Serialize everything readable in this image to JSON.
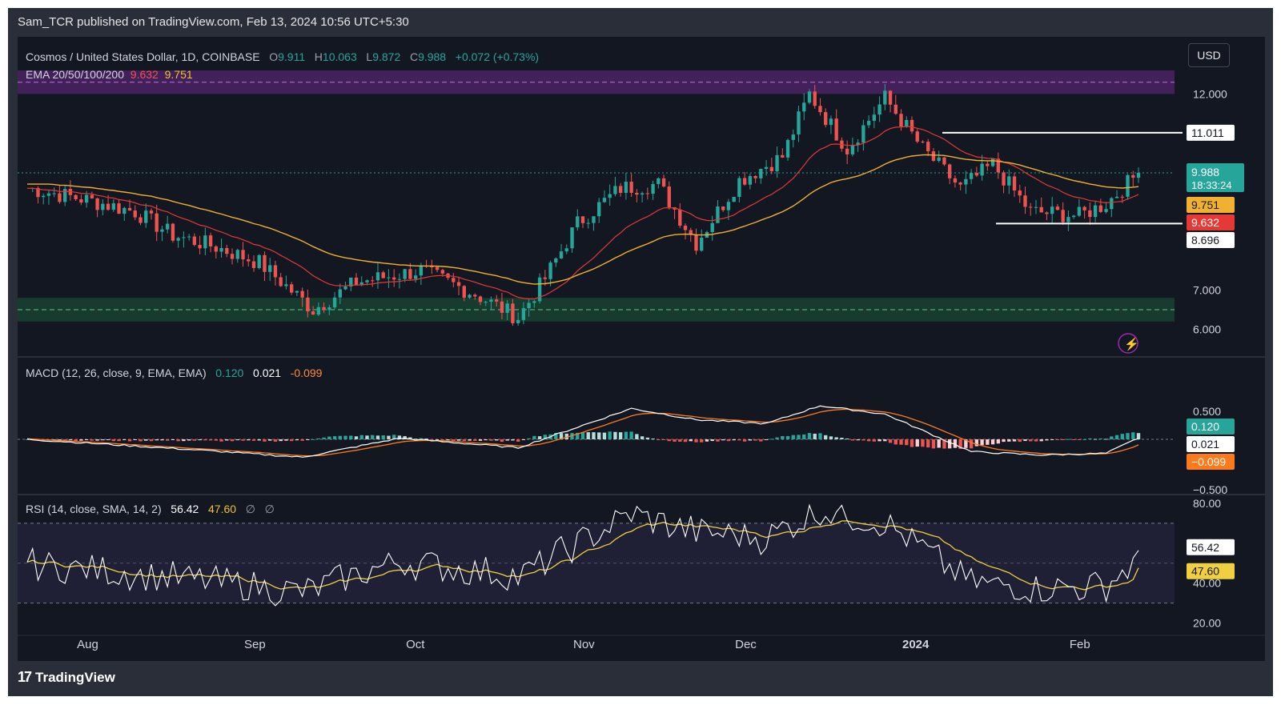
{
  "header": {
    "published_by": "Sam_TCR published on TradingView.com, Feb 13, 2024 10:56 UTC+5:30"
  },
  "footer": {
    "logo_text": "TradingView"
  },
  "currency_button": "USD",
  "symbol_legend": {
    "name": "Cosmos / United States Dollar, 1D, COINBASE",
    "o_label": "O",
    "o_value": "9.911",
    "h_label": "H",
    "h_value": "10.063",
    "l_label": "L",
    "l_value": "9.872",
    "c_label": "C",
    "c_value": "9.988",
    "change": "+0.072 (+0.73%)"
  },
  "ema_legend": {
    "name": "EMA 20/50/100/200",
    "v1": "9.632",
    "v2": "9.751"
  },
  "macd_legend": {
    "name": "MACD (12, 26, close, 9, EMA, EMA)",
    "hist": "0.120",
    "macd": "0.021",
    "signal": "-0.099"
  },
  "rsi_legend": {
    "name": "RSI (14, close, SMA, 14, 2)",
    "rsi": "56.42",
    "sma": "47.60",
    "extra1": "∅",
    "extra2": "∅"
  },
  "price_axis": {
    "ticks": [
      "12.000",
      "7.000",
      "6.000"
    ],
    "tags": {
      "resistance": "11.011",
      "last_price": "9.988",
      "countdown": "18:33:24",
      "ema50": "9.751",
      "ema20": "9.632",
      "support": "8.696"
    }
  },
  "macd_axis": {
    "ticks": [
      "0.500",
      "−0.500"
    ],
    "tags": {
      "hist": "0.120",
      "macd": "0.021",
      "signal": "−0.099"
    }
  },
  "rsi_axis": {
    "ticks": [
      "80.00",
      "40.00",
      "20.00"
    ],
    "tags": {
      "rsi": "56.42",
      "sma": "47.60"
    }
  },
  "time_axis": [
    "Aug",
    "Sep",
    "Oct",
    "Nov",
    "Dec",
    "2024",
    "Feb"
  ],
  "colors": {
    "up": "#26a69a",
    "down": "#ef5350",
    "ema20": "#e53935",
    "ema50": "#f0b030",
    "macd": "#ffffff",
    "signal": "#ff7a1a",
    "rsi": "#ffffff",
    "rsi_sma": "#f0d040",
    "resistance_zone": "#6a2a8a",
    "support_zone": "#1e5a3a"
  },
  "chart_data": [
    {
      "type": "candlestick",
      "title": "Cosmos / United States Dollar, 1D, COINBASE",
      "x_range": [
        "2024-07-21",
        "2024-02-12"
      ],
      "ylim": [
        5.5,
        12.6
      ],
      "zones": [
        {
          "name": "resistance",
          "y_range": [
            12.0,
            12.6
          ]
        },
        {
          "name": "support",
          "y_range": [
            6.2,
            6.8
          ]
        }
      ],
      "levels": [
        11.011,
        8.696
      ],
      "close_anchors": [
        [
          "2023-07-21",
          9.6
        ],
        [
          "2023-08-01",
          9.3
        ],
        [
          "2023-08-10",
          9.0
        ],
        [
          "2023-08-17",
          8.4
        ],
        [
          "2023-08-25",
          8.1
        ],
        [
          "2023-09-02",
          7.7
        ],
        [
          "2023-09-12",
          6.5
        ],
        [
          "2023-09-20",
          7.2
        ],
        [
          "2023-09-28",
          7.4
        ],
        [
          "2023-10-02",
          7.5
        ],
        [
          "2023-10-12",
          6.9
        ],
        [
          "2023-10-20",
          6.3
        ],
        [
          "2023-10-25",
          7.3
        ],
        [
          "2023-10-31",
          8.7
        ],
        [
          "2023-11-08",
          9.6
        ],
        [
          "2023-11-15",
          9.7
        ],
        [
          "2023-11-22",
          8.2
        ],
        [
          "2023-11-30",
          9.8
        ],
        [
          "2023-12-08",
          10.4
        ],
        [
          "2023-12-13",
          12.0
        ],
        [
          "2023-12-20",
          10.6
        ],
        [
          "2023-12-27",
          11.9
        ],
        [
          "2024-01-03",
          10.6
        ],
        [
          "2024-01-10",
          9.6
        ],
        [
          "2024-01-16",
          10.2
        ],
        [
          "2024-01-23",
          9.0
        ],
        [
          "2024-02-01",
          8.9
        ],
        [
          "2024-02-06",
          9.2
        ],
        [
          "2024-02-12",
          9.988
        ]
      ],
      "ema20_last": 9.632,
      "ema50_last": 9.751
    },
    {
      "type": "line",
      "title": "MACD (12, 26, close, 9, EMA, EMA)",
      "ylim": [
        -0.5,
        0.6
      ],
      "series": [
        {
          "name": "MACD",
          "values_at_anchors": [
            [
              "2023-07-21",
              0.0
            ],
            [
              "2023-08-20",
              -0.18
            ],
            [
              "2023-09-10",
              -0.32
            ],
            [
              "2023-09-28",
              0.02
            ],
            [
              "2023-10-20",
              -0.15
            ],
            [
              "2023-11-10",
              0.55
            ],
            [
              "2023-11-22",
              0.35
            ],
            [
              "2023-12-05",
              0.28
            ],
            [
              "2023-12-15",
              0.6
            ],
            [
              "2023-12-27",
              0.45
            ],
            [
              "2024-01-12",
              -0.22
            ],
            [
              "2024-01-25",
              -0.28
            ],
            [
              "2024-02-06",
              -0.25
            ],
            [
              "2024-02-12",
              0.021
            ]
          ]
        },
        {
          "name": "Signal",
          "last": -0.099
        },
        {
          "name": "Histogram",
          "last": 0.12
        }
      ]
    },
    {
      "type": "line",
      "title": "RSI (14, close, SMA, 14, 2)",
      "ylim": [
        15,
        82
      ],
      "bands": [
        30,
        70
      ],
      "series": [
        {
          "name": "RSI",
          "last": 56.42
        },
        {
          "name": "RSI SMA",
          "last": 47.6
        }
      ]
    }
  ]
}
